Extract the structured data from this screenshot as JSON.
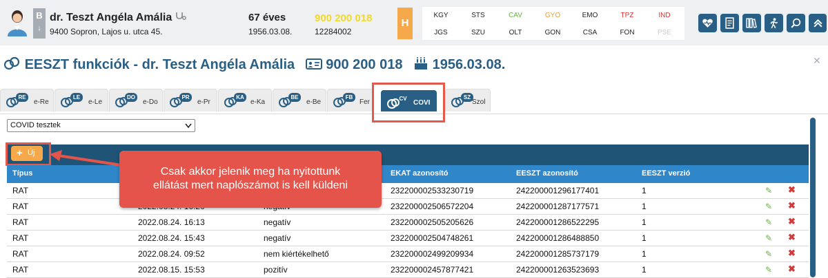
{
  "patient": {
    "name": "dr. Teszt Angéla Amália",
    "address": "9400 Sopron, Lajos u. utca 45.",
    "age": "67 éves",
    "birthdate": "1956.03.08.",
    "taj": "900 200 018",
    "id_number": "12284002",
    "b_label": "B",
    "h_label": "H"
  },
  "code_rows": [
    [
      {
        "label": "KGY",
        "color": "#222222"
      },
      {
        "label": "STS",
        "color": "#222222"
      },
      {
        "label": "CAV",
        "color": "#6ab04c"
      },
      {
        "label": "GYO",
        "color": "#e2a23b"
      },
      {
        "label": "EMO",
        "color": "#222222"
      },
      {
        "label": "TPZ",
        "color": "#d93333"
      },
      {
        "label": "IND",
        "color": "#d93333"
      }
    ],
    [
      {
        "label": "JGS",
        "color": "#222222"
      },
      {
        "label": "SZU",
        "color": "#222222"
      },
      {
        "label": "OLT",
        "color": "#222222"
      },
      {
        "label": "GON",
        "color": "#222222"
      },
      {
        "label": "CSA",
        "color": "#222222"
      },
      {
        "label": "FON",
        "color": "#222222"
      },
      {
        "label": "PSE",
        "color": "#cccccc"
      }
    ]
  ],
  "toolbar_icons": [
    "heart-pulse-icon",
    "document-icon",
    "books-icon",
    "person-run-icon",
    "search-icon",
    "double-chevron-icon"
  ],
  "eeszt_title": {
    "text": "EESZT funkciók - dr. Teszt Angéla Amália",
    "taj": "900 200 018",
    "birthdate": "1956.03.08."
  },
  "tabs": [
    {
      "badge": "RE",
      "label": "e-Re"
    },
    {
      "badge": "LE",
      "label": "e-Le"
    },
    {
      "badge": "DO",
      "label": "e-Do"
    },
    {
      "badge": "PR",
      "label": "e-Pr"
    },
    {
      "badge": "KA",
      "label": "e-Ka"
    },
    {
      "badge": "BE",
      "label": "e-Be"
    },
    {
      "badge": "FB",
      "label": "Fer"
    },
    {
      "badge": "CV",
      "label": "COVI"
    },
    {
      "badge": "SZ",
      "label": "Szol"
    }
  ],
  "select": {
    "value": "COVID tesztek"
  },
  "new_button": {
    "label": "Új"
  },
  "callout": {
    "line1": "Csak akkor jelenik meg ha nyitottunk",
    "line2": "ellátást mert naplószámot is kell küldeni"
  },
  "table": {
    "headers": [
      "Típus",
      "EKAT azonosító",
      "EESZT azonosító",
      "EESZT verzió"
    ],
    "rows": [
      {
        "type": "RAT",
        "date": "",
        "result": "",
        "ekat": "232200002533230719",
        "eeszt": "242200001296177401",
        "version": "1"
      },
      {
        "type": "RAT",
        "date": "2022.08.24. 16:20",
        "result": "negatív",
        "ekat": "232200002506572204",
        "eeszt": "242200001287177571",
        "version": "1"
      },
      {
        "type": "RAT",
        "date": "2022.08.24. 16:13",
        "result": "negatív",
        "ekat": "232200002505205626",
        "eeszt": "242200001286522295",
        "version": "1"
      },
      {
        "type": "RAT",
        "date": "2022.08.24. 15:43",
        "result": "negatív",
        "ekat": "232200002504748261",
        "eeszt": "242200001286488850",
        "version": "1"
      },
      {
        "type": "RAT",
        "date": "2022.08.24. 09:52",
        "result": "nem kiértékelhető",
        "ekat": "232200002499209934",
        "eeszt": "242200001285737179",
        "version": "1"
      },
      {
        "type": "RAT",
        "date": "2022.08.15. 15:53",
        "result": "pozitív",
        "ekat": "232200002457877421",
        "eeszt": "242200001263523693",
        "version": "1"
      }
    ]
  }
}
